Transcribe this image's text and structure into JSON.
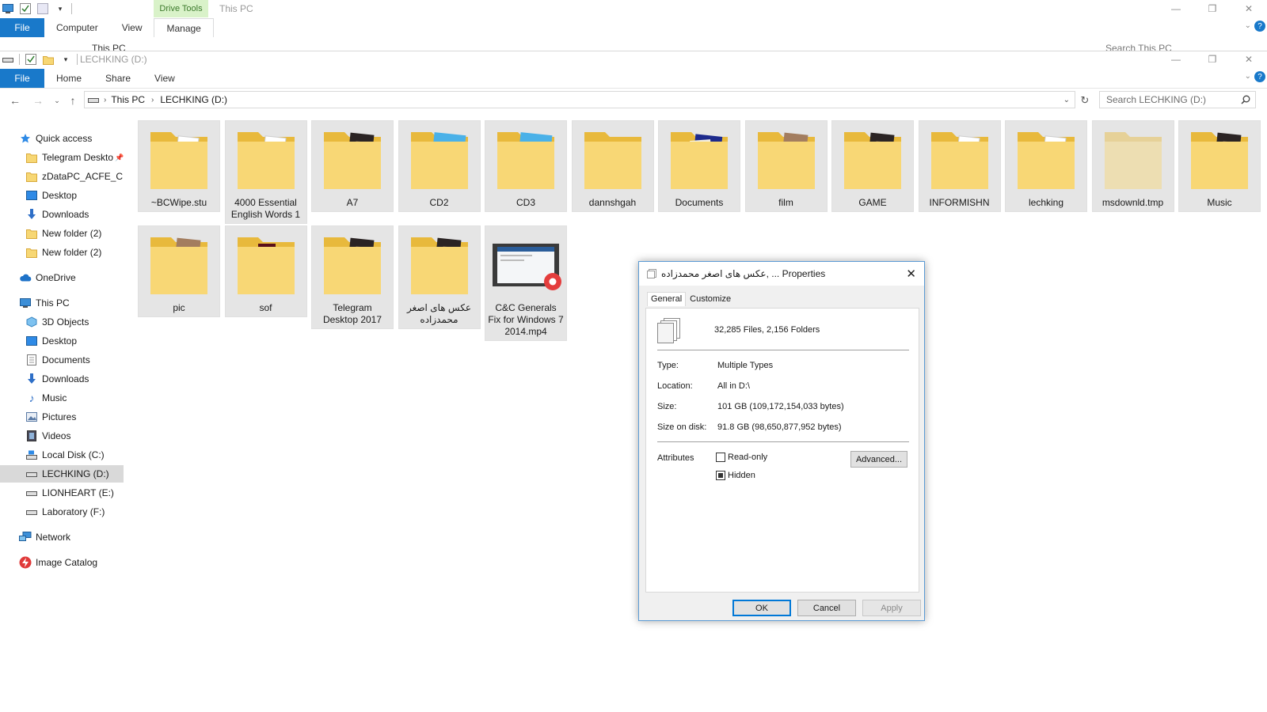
{
  "back_window": {
    "context_tab": "Drive Tools",
    "title": "This PC",
    "tabs": [
      "File",
      "Computer",
      "View",
      "Manage"
    ],
    "breadcrumb": "This PC",
    "search_placeholder": "Search This PC"
  },
  "front_window": {
    "title": "LECHKING (D:)",
    "tabs": {
      "file": "File",
      "home": "Home",
      "share": "Share",
      "view": "View"
    },
    "breadcrumb": {
      "root": "This PC",
      "current": "LECHKING (D:)"
    },
    "search_placeholder": "Search LECHKING (D:)",
    "accent": "#1979ca"
  },
  "nav": {
    "quick_access": "Quick access",
    "qa_items": [
      "Telegram Deskto",
      "zDataPC_ACFE_C",
      "Desktop",
      "Downloads",
      "New folder (2)",
      "New folder (2)"
    ],
    "onedrive": "OneDrive",
    "this_pc": "This PC",
    "pc_items": [
      "3D Objects",
      "Desktop",
      "Documents",
      "Downloads",
      "Music",
      "Pictures",
      "Videos",
      "Local Disk (C:)",
      "LECHKING (D:)",
      "LIONHEART (E:)",
      "Laboratory (F:)"
    ],
    "network": "Network",
    "image_catalog": "Image Catalog"
  },
  "files": [
    {
      "name": "~BCWipe.stu",
      "kind": "folder-doc"
    },
    {
      "name": "4000 Essential English Words 1",
      "kind": "folder-doc"
    },
    {
      "name": "A7",
      "kind": "folder-photo-dark"
    },
    {
      "name": "CD2",
      "kind": "folder-chrome"
    },
    {
      "name": "CD3",
      "kind": "folder-chrome"
    },
    {
      "name": "dannshgah",
      "kind": "folder"
    },
    {
      "name": "Documents",
      "kind": "folder-blue"
    },
    {
      "name": "film",
      "kind": "folder-photo"
    },
    {
      "name": "GAME",
      "kind": "folder-photo-dark"
    },
    {
      "name": "INFORMISHN",
      "kind": "folder-doc"
    },
    {
      "name": "lechking",
      "kind": "folder-doc"
    },
    {
      "name": "msdownld.tmp",
      "kind": "folder-faded"
    },
    {
      "name": "Music",
      "kind": "folder-photo-dark"
    },
    {
      "name": "pic",
      "kind": "folder-photo"
    },
    {
      "name": "sof",
      "kind": "folder-cd"
    },
    {
      "name": "Telegram Desktop 2017",
      "kind": "folder-photo-dark"
    },
    {
      "name": "عکس های اصغر محمدزاده",
      "kind": "folder-photo-dark"
    },
    {
      "name": "C&C Generals Fix for Windows 7 2014.mp4",
      "kind": "video"
    }
  ],
  "dialog": {
    "title": "عکس های اصغر محمدزاده, ... Properties",
    "tabs": {
      "general": "General",
      "customize": "Customize"
    },
    "summary": "32,285 Files, 2,156 Folders",
    "labels": {
      "type": "Type:",
      "location": "Location:",
      "size": "Size:",
      "size_on_disk": "Size on disk:",
      "attributes": "Attributes"
    },
    "values": {
      "type": "Multiple Types",
      "location": "All in D:\\",
      "size": "101 GB (109,172,154,033 bytes)",
      "size_on_disk": "91.8 GB (98,650,877,952 bytes)"
    },
    "attributes": {
      "readonly": "Read-only",
      "hidden": "Hidden",
      "advanced": "Advanced..."
    },
    "buttons": {
      "ok": "OK",
      "cancel": "Cancel",
      "apply": "Apply"
    }
  }
}
